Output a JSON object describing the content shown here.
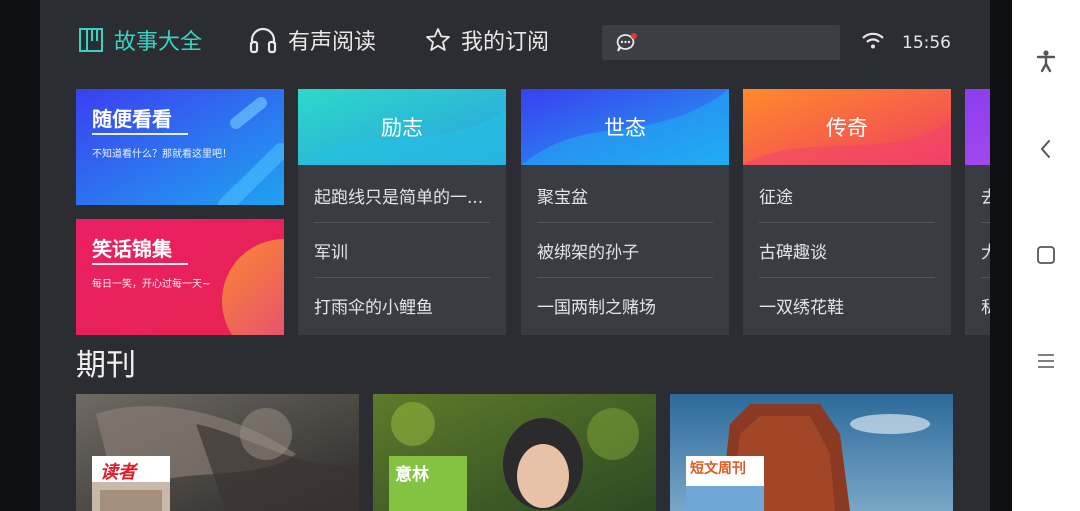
{
  "header": {
    "tabs": [
      {
        "label": "故事大全",
        "icon": "book-frame-icon",
        "active": true
      },
      {
        "label": "有声阅读",
        "icon": "headphones-icon",
        "active": false
      },
      {
        "label": "我的订阅",
        "icon": "star-outline-icon",
        "active": false
      }
    ],
    "search_icon": "chat-bubble-icon",
    "wifi_icon": "wifi-icon",
    "time": "15:56"
  },
  "promos": [
    {
      "title": "随便看看",
      "subtitle": "不知道看什么？那就看这里吧！"
    },
    {
      "title": "笑话锦集",
      "subtitle": "每日一笑，开心过每一天~"
    }
  ],
  "categories": [
    {
      "name": "励志",
      "items": [
        "起跑线只是简单的一...",
        "军训",
        "打雨伞的小鲤鱼"
      ]
    },
    {
      "name": "世态",
      "items": [
        "聚宝盆",
        "被绑架的孙子",
        "一国两制之赌场"
      ]
    },
    {
      "name": "传奇",
      "items": [
        "征途",
        "古碑趣谈",
        "一双绣花鞋"
      ]
    },
    {
      "name": "",
      "items": [
        "去",
        "大",
        "私"
      ]
    }
  ],
  "section": {
    "title": "期刊"
  },
  "magazines": [
    {
      "cover_title": "读者"
    },
    {
      "cover_title": "意林"
    },
    {
      "cover_title": "短文周刊"
    }
  ],
  "system_nav": [
    "accessibility-icon",
    "back-icon",
    "home-icon",
    "menu-icon"
  ],
  "colors": {
    "accent": "#3ad3c2",
    "background": "#2b2d33",
    "card": "#3a3c43"
  }
}
